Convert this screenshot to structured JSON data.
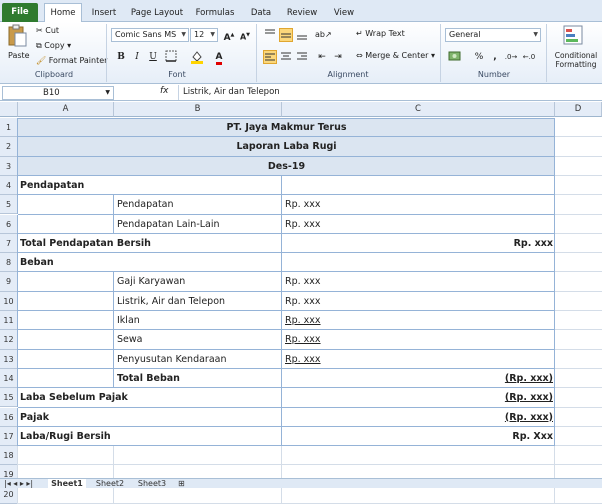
{
  "tabs": [
    "File",
    "Home",
    "Insert",
    "Page Layout",
    "Formulas",
    "Data",
    "Review",
    "View"
  ],
  "clipboard": {
    "paste": "Paste",
    "cut": "Cut",
    "copy": "Copy",
    "format_painter": "Format Painter",
    "label": "Clipboard"
  },
  "font": {
    "name": "Comic Sans MS",
    "size": "12",
    "label": "Font",
    "bold": "B",
    "italic": "I",
    "underline": "U"
  },
  "alignment": {
    "wrap_text": "Wrap Text",
    "merge_center": "Merge & Center",
    "label": "Alignment"
  },
  "number": {
    "format": "General",
    "percent": "%",
    "comma": ",",
    "label": "Number"
  },
  "styles": {
    "conditional": "Conditional Formatting",
    "conditional_line1": "Conditional",
    "conditional_line2": "Formatting"
  },
  "formula_bar": {
    "name_box": "B10",
    "fx": "fx",
    "content": "Listrik, Air dan Telepon"
  },
  "columns": [
    "A",
    "B",
    "C",
    "D"
  ],
  "rows": [
    {
      "n": "1",
      "a": "",
      "b": "",
      "c": "",
      "merged": "PT. Jaya Makmur Terus"
    },
    {
      "n": "2",
      "a": "",
      "b": "",
      "c": "",
      "merged": "Laporan Laba Rugi"
    },
    {
      "n": "3",
      "a": "",
      "b": "",
      "c": "",
      "merged": "Des-19"
    },
    {
      "n": "4",
      "a": "Pendapatan",
      "b": "",
      "c": ""
    },
    {
      "n": "5",
      "a": "",
      "b": "Pendapatan",
      "c": "Rp. xxx"
    },
    {
      "n": "6",
      "a": "",
      "b": "Pendapatan Lain-Lain",
      "c": "Rp. xxx"
    },
    {
      "n": "7",
      "a": "Total Pendapatan Bersih",
      "b": "",
      "c": "Rp. xxx"
    },
    {
      "n": "8",
      "a": "Beban",
      "b": "",
      "c": ""
    },
    {
      "n": "9",
      "a": "",
      "b": "Gaji Karyawan",
      "c": "Rp. xxx"
    },
    {
      "n": "10",
      "a": "",
      "b": "Listrik, Air dan Telepon",
      "c": "Rp. xxx"
    },
    {
      "n": "11",
      "a": "",
      "b": "Iklan",
      "c": "Rp. xxx"
    },
    {
      "n": "12",
      "a": "",
      "b": "Sewa",
      "c": "Rp. xxx"
    },
    {
      "n": "13",
      "a": "",
      "b": "Penyusutan Kendaraan",
      "c": "Rp. xxx"
    },
    {
      "n": "14",
      "a": "",
      "b": "Total Beban",
      "c": "(Rp. xxx)"
    },
    {
      "n": "15",
      "a": "Laba Sebelum Pajak",
      "b": "",
      "c": "(Rp. xxx)"
    },
    {
      "n": "16",
      "a": "Pajak",
      "b": "",
      "c": "(Rp. xxx)"
    },
    {
      "n": "17",
      "a": "Laba/Rugi Bersih",
      "b": "",
      "c": "Rp. Xxx"
    },
    {
      "n": "18",
      "a": "",
      "b": "",
      "c": ""
    },
    {
      "n": "19",
      "a": "",
      "b": "",
      "c": ""
    },
    {
      "n": "20",
      "a": "",
      "b": "",
      "c": ""
    }
  ],
  "sheets": [
    "Sheet1",
    "Sheet2",
    "Sheet3"
  ],
  "colors": {
    "header_band": "#dbe5f1",
    "border": "#95b3d7",
    "file_tab": "#2f7b2f"
  }
}
